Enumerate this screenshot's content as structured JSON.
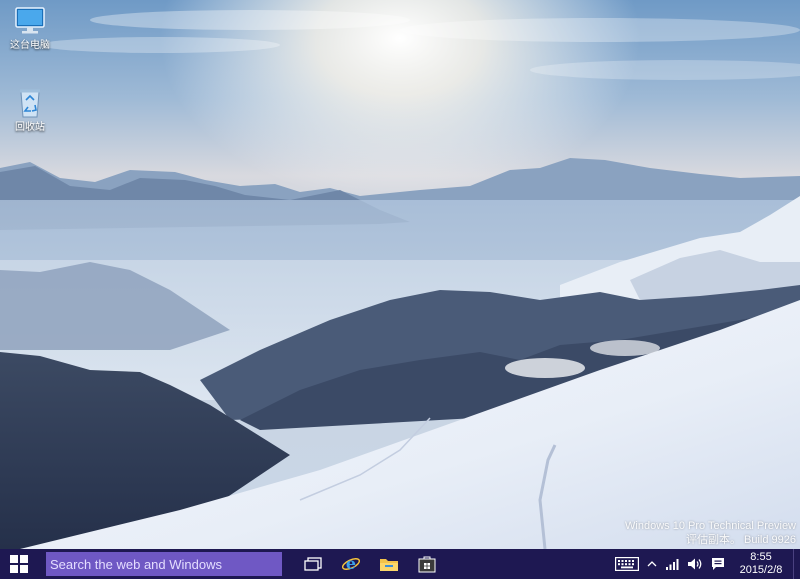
{
  "desktop": {
    "icons": [
      {
        "label": "这台电脑",
        "icon": "monitor-icon"
      },
      {
        "label": "回收站",
        "icon": "recycle-bin-icon"
      }
    ],
    "watermark": {
      "line1": "Windows 10 Pro Technical Preview",
      "line2": "评估副本。 Build 9926"
    }
  },
  "taskbar": {
    "search_placeholder": "Search the web and Windows",
    "apps": [
      "task-view-icon",
      "internet-explorer-icon",
      "file-explorer-icon",
      "store-icon"
    ],
    "tray": {
      "icons": [
        "keyboard-icon",
        "chevron-up-icon",
        "network-icon",
        "volume-icon",
        "action-center-icon"
      ],
      "time": "8:55",
      "date": "2015/2/8"
    },
    "colors": {
      "taskbar": "#1e1852",
      "search": "#6f58c4"
    }
  }
}
